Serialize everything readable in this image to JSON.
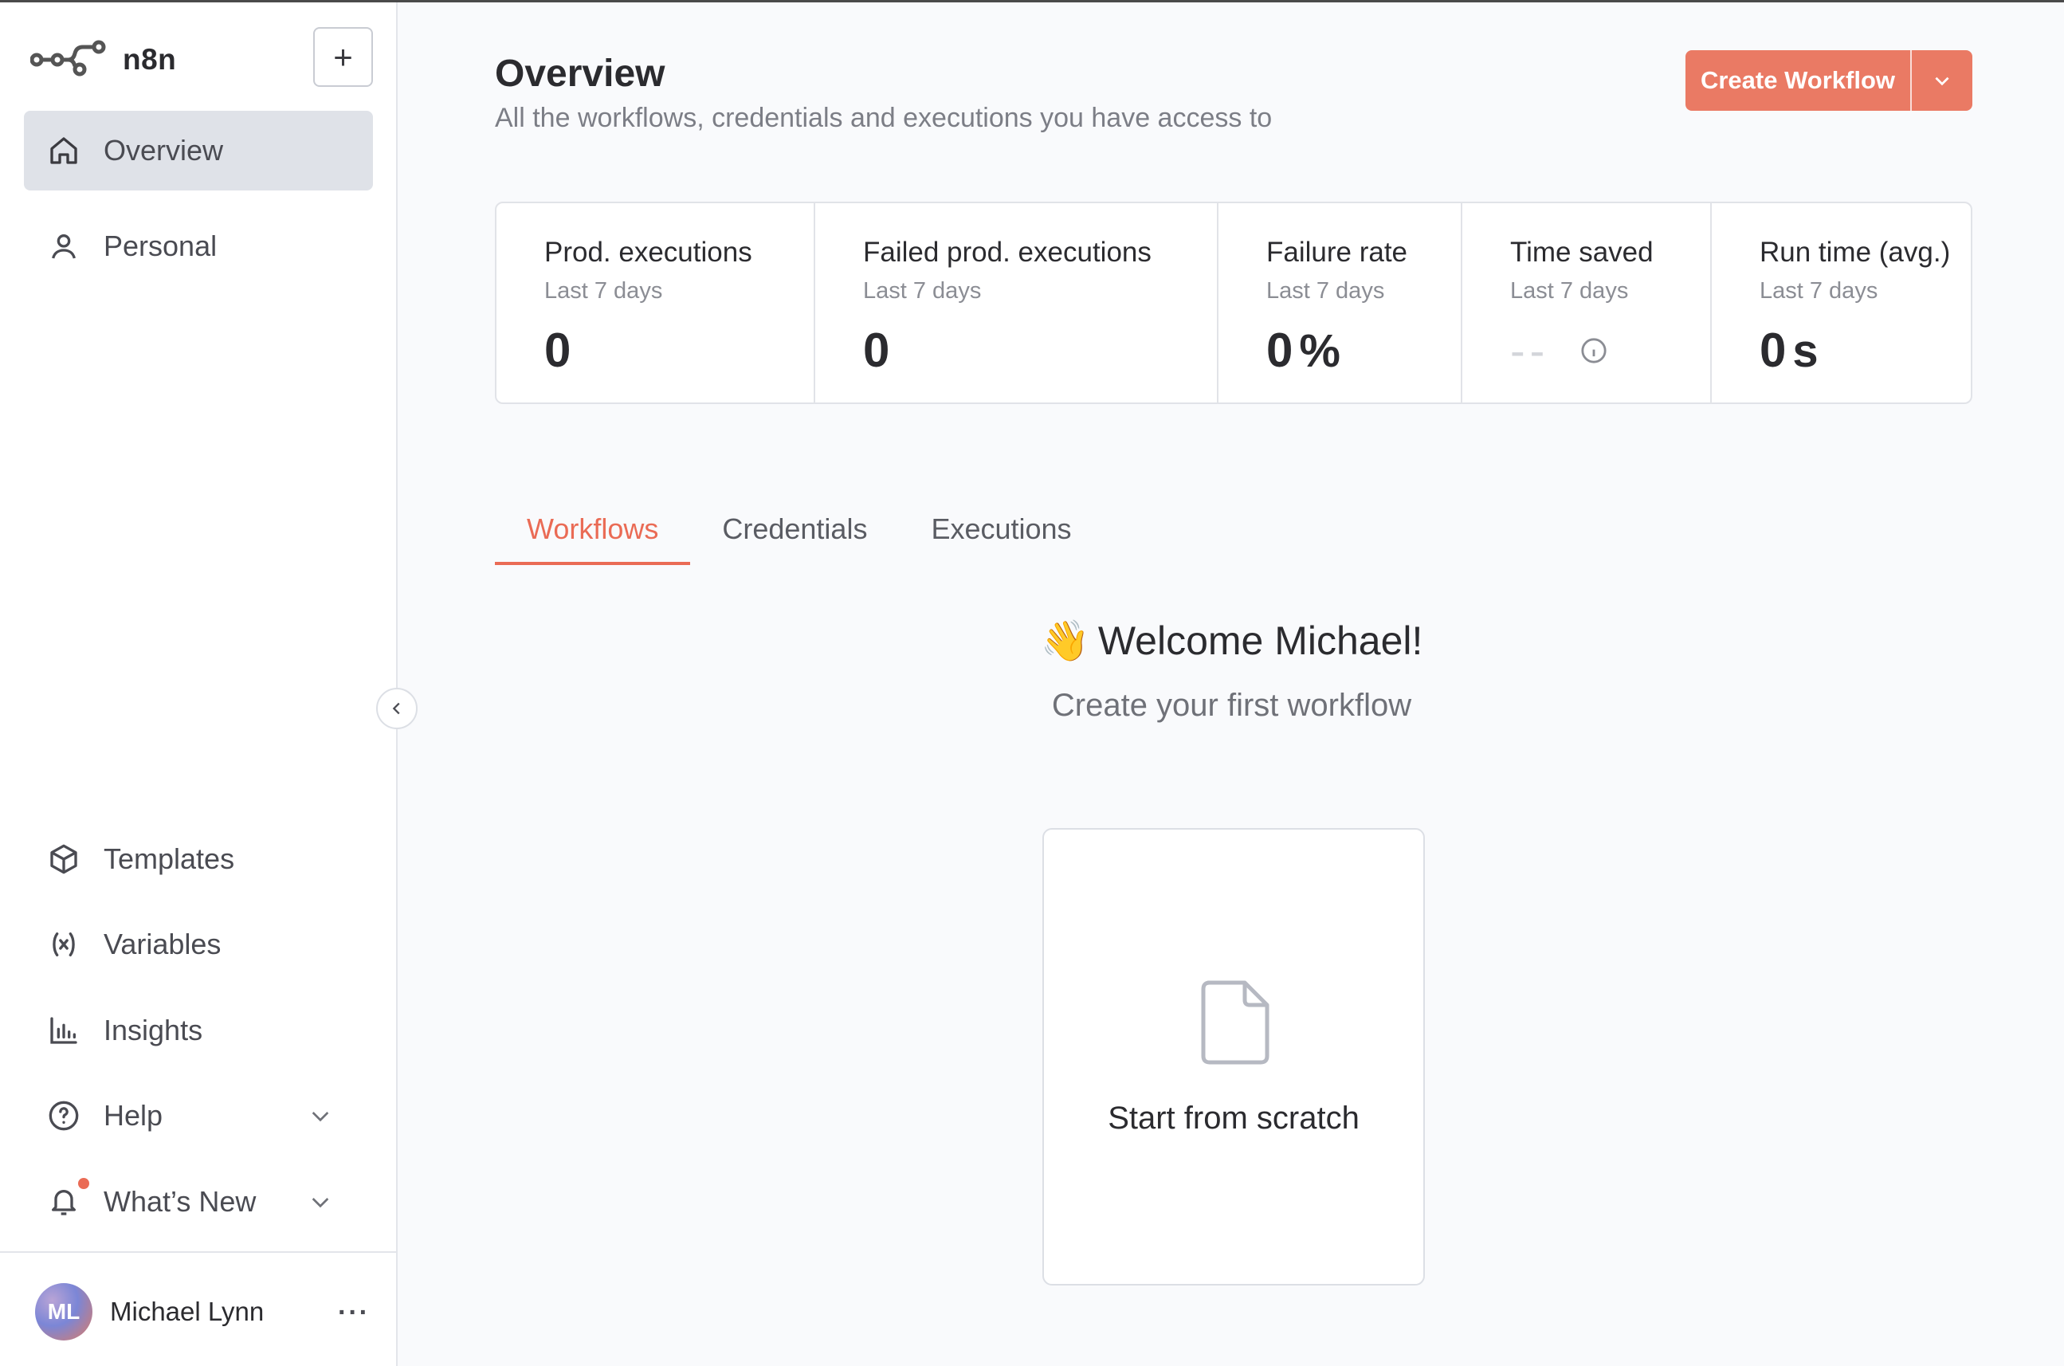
{
  "app": {
    "name": "n8n"
  },
  "sidebar": {
    "add_label": "+",
    "top_items": [
      {
        "label": "Overview",
        "icon": "home-icon",
        "active": true
      },
      {
        "label": "Personal",
        "icon": "user-icon",
        "active": false
      }
    ],
    "bottom_items": [
      {
        "label": "Templates",
        "icon": "templates-box-icon"
      },
      {
        "label": "Variables",
        "icon": "variables-icon"
      },
      {
        "label": "Insights",
        "icon": "bar-chart-icon"
      },
      {
        "label": "Help",
        "icon": "help-circle-icon",
        "has_chevron": true
      },
      {
        "label": "What’s New",
        "icon": "bell-icon",
        "has_chevron": true,
        "has_badge": true
      }
    ],
    "user": {
      "initials": "ML",
      "name": "Michael Lynn",
      "more": "···"
    }
  },
  "header": {
    "title": "Overview",
    "subtitle": "All the workflows, credentials and executions you have access to",
    "create_button": "Create Workflow"
  },
  "stats": [
    {
      "title": "Prod. executions",
      "period": "Last 7 days",
      "value": "0",
      "unit": ""
    },
    {
      "title": "Failed prod. executions",
      "period": "Last 7 days",
      "value": "0",
      "unit": ""
    },
    {
      "title": "Failure rate",
      "period": "Last 7 days",
      "value": "0",
      "unit": "%"
    },
    {
      "title": "Time saved",
      "period": "Last 7 days",
      "value": "--",
      "unit": ""
    },
    {
      "title": "Run time (avg.)",
      "period": "Last 7 days",
      "value": "0",
      "unit": "s"
    }
  ],
  "tabs": [
    {
      "label": "Workflows",
      "active": true
    },
    {
      "label": "Credentials",
      "active": false
    },
    {
      "label": "Executions",
      "active": false
    }
  ],
  "welcome": {
    "emoji": "👋",
    "title": "Welcome Michael!",
    "subtitle": "Create your first workflow",
    "card_label": "Start from scratch"
  },
  "colors": {
    "accent": "#ea6b55",
    "button": "#ea7a64",
    "active_nav": "#dfe2e8",
    "background": "#f9fafc"
  }
}
